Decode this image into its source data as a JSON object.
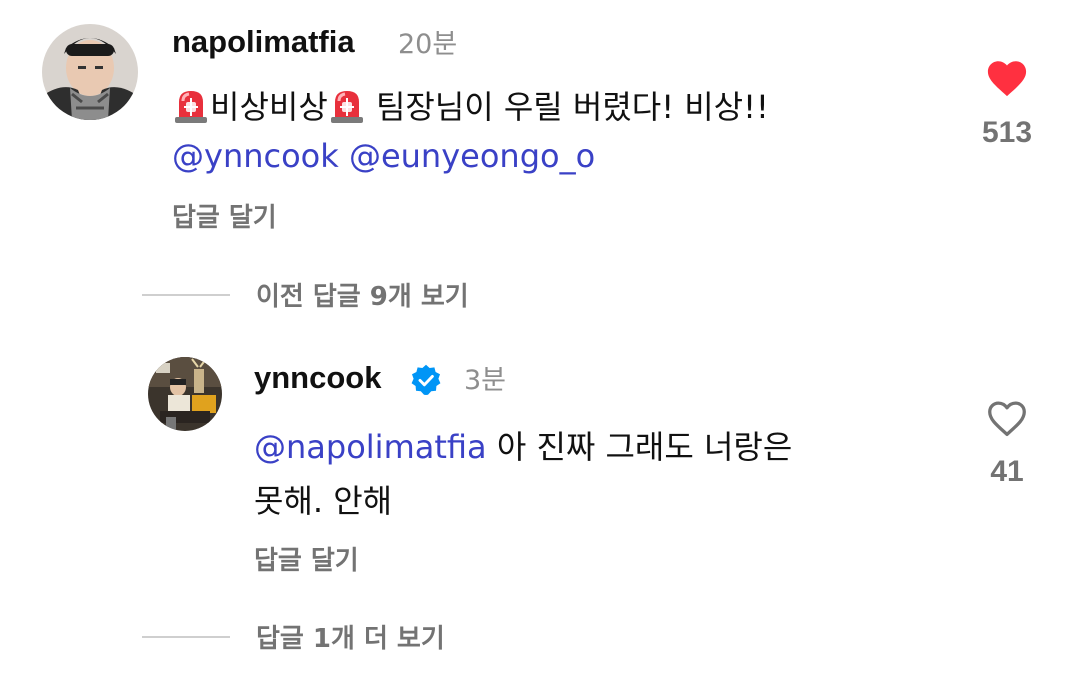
{
  "comments": [
    {
      "username": "napolimatfia",
      "time": "20분",
      "verified": false,
      "text_parts": {
        "word1": "비상비상",
        "word2": " 팀장님이 우릴 버렸다! 비상!!"
      },
      "mentions": [
        "ynncook",
        "eunyeongo_o"
      ],
      "reply_label": "답글 달기",
      "liked": true,
      "like_count": "513"
    },
    {
      "username": "ynncook",
      "time": "3분",
      "verified": true,
      "mention": "napolimatfia",
      "text_line1": " 아 진짜 그래도 너랑은",
      "text_line2": "못해. 안해",
      "reply_label": "답글 달기",
      "liked": false,
      "like_count": "41"
    }
  ],
  "threads": {
    "view_previous": "이전 답글 9개 보기",
    "view_more": "답글 1개 더 보기"
  },
  "colors": {
    "mention": "#3a41c6",
    "like_red": "#ff3040",
    "verified_blue": "#0095f6",
    "secondary_text": "#737373"
  },
  "icons": {
    "mention_icon": "threads-at-icon",
    "emoji": "police-siren-emoji"
  }
}
